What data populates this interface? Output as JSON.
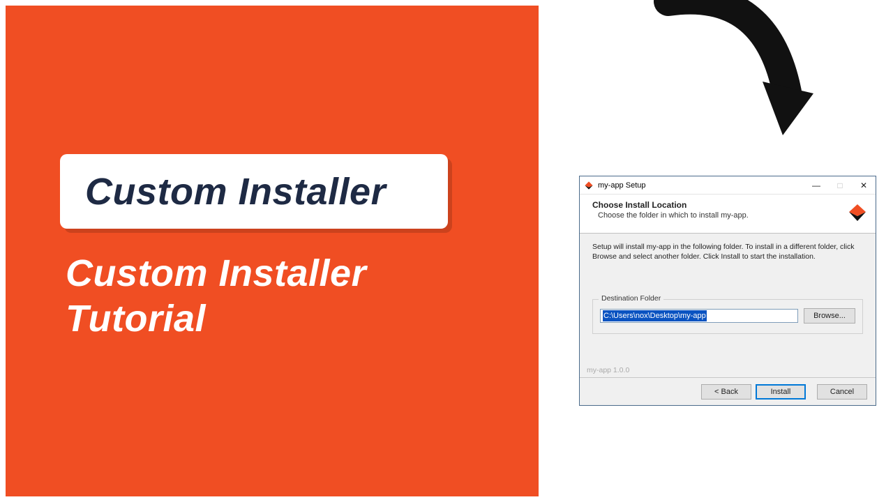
{
  "left": {
    "card_title": "Custom Installer",
    "subtitle_line1": "Custom Installer",
    "subtitle_line2": "Tutorial"
  },
  "dialog": {
    "titlebar": "my-app Setup",
    "header_title": "Choose Install Location",
    "header_sub": "Choose the folder in which to install my-app.",
    "instructions": "Setup will install my-app in the following folder. To install in a different folder, click Browse and select another folder. Click Install to start the installation.",
    "dest_legend": "Destination Folder",
    "dest_path": "C:\\Users\\nox\\Desktop\\my-app",
    "browse_label": "Browse...",
    "version": "my-app 1.0.0",
    "buttons": {
      "back": "< Back",
      "install": "Install",
      "cancel": "Cancel"
    },
    "win": {
      "min": "—",
      "max": "□",
      "close": "✕"
    }
  }
}
